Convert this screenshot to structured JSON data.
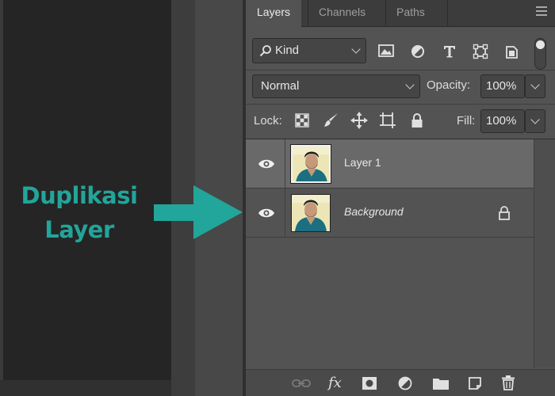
{
  "tabs": [
    {
      "label": "Layers",
      "active": true
    },
    {
      "label": "Channels",
      "active": false
    },
    {
      "label": "Paths",
      "active": false
    }
  ],
  "filter": {
    "kind_label": "Kind",
    "filter_icons": [
      "image-filter-icon",
      "adjustment-filter-icon",
      "type-filter-icon",
      "shape-filter-icon",
      "smart-object-filter-icon",
      "filter-toggle-icon"
    ]
  },
  "blend": {
    "mode": "Normal",
    "opacity_label": "Opacity:",
    "opacity_value": "100%"
  },
  "lock": {
    "label": "Lock:",
    "icons": [
      "lock-transparent-pixels-icon",
      "lock-image-pixels-icon",
      "lock-position-icon",
      "lock-artboard-icon",
      "lock-all-icon"
    ],
    "fill_label": "Fill:",
    "fill_value": "100%"
  },
  "layers": [
    {
      "name": "Layer 1",
      "selected": true,
      "visible": true,
      "locked": false
    },
    {
      "name": "Background",
      "selected": false,
      "visible": true,
      "locked": true
    }
  ],
  "bottom_icons": [
    "link-layers-icon",
    "fx-icon",
    "add-mask-icon",
    "new-adjustment-icon",
    "new-group-icon",
    "new-layer-icon",
    "delete-layer-icon"
  ],
  "annotation": {
    "line1": "Duplikasi",
    "line2": "Layer",
    "color": "#22a59a"
  },
  "colors": {
    "panel_bg": "#535353",
    "selected_row": "#696969",
    "tab_bar": "#3c3c3c",
    "accent_teal": "#22a59a"
  }
}
